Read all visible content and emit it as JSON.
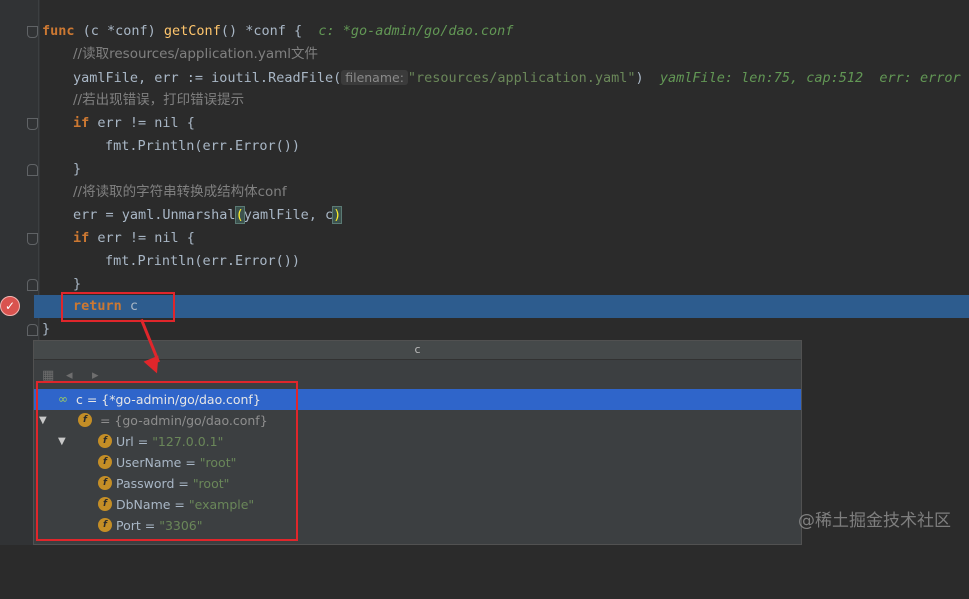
{
  "editor": {
    "lines": [
      {
        "parts": [
          "func",
          " (c *conf) ",
          "getConf",
          "() *conf {",
          "c: *go-admin/go/dao.conf"
        ]
      },
      {
        "comment": "//读取resources/application.yaml文件"
      },
      {
        "parts": [
          "yamlFile, err := ioutil.ReadFile(",
          "filename:",
          "\"resources/application.yaml\"",
          ")",
          "yamlFile: len:75, cap:512  err: error"
        ]
      },
      {
        "comment": "//若出现错误，打印错误提示"
      },
      {
        "parts": [
          "if",
          " err != nil {"
        ]
      },
      {
        "parts": [
          "fmt.Println(err.Error())"
        ]
      },
      {
        "parts": [
          "}"
        ]
      },
      {
        "comment": "//将读取的字符串转换成结构体conf"
      },
      {
        "parts": [
          "err = yaml.Unmarshal",
          "(",
          "yamlFile, c",
          ")"
        ]
      },
      {
        "parts": [
          "if",
          " err != nil {"
        ]
      },
      {
        "parts": [
          "fmt.Println(err.Error())"
        ]
      },
      {
        "parts": [
          "}"
        ]
      },
      {
        "parts": [
          "return",
          " c"
        ]
      },
      {
        "parts": [
          "}"
        ]
      }
    ]
  },
  "popup": {
    "title": "c",
    "root": {
      "label": "c = {*go-admin/go/dao.conf}"
    },
    "child": {
      "label": " = {go-admin/go/dao.conf}"
    },
    "fields": [
      {
        "name": "Url",
        "value": "\"127.0.0.1\""
      },
      {
        "name": "UserName",
        "value": "\"root\""
      },
      {
        "name": "Password",
        "value": "\"root\""
      },
      {
        "name": "DbName",
        "value": "\"example\""
      },
      {
        "name": "Port",
        "value": "\"3306\""
      }
    ]
  },
  "watermark": "@稀土掘金技术社区",
  "colors": {
    "keyword": "#cc7832",
    "function": "#ffc66d",
    "string": "#6a8759",
    "selection": "#2f65ca",
    "annotation": "#e0262b"
  },
  "icons": [
    "breakpoint-icon",
    "field-icon",
    "watch-icon",
    "back-arrow-icon",
    "forward-arrow-icon"
  ]
}
